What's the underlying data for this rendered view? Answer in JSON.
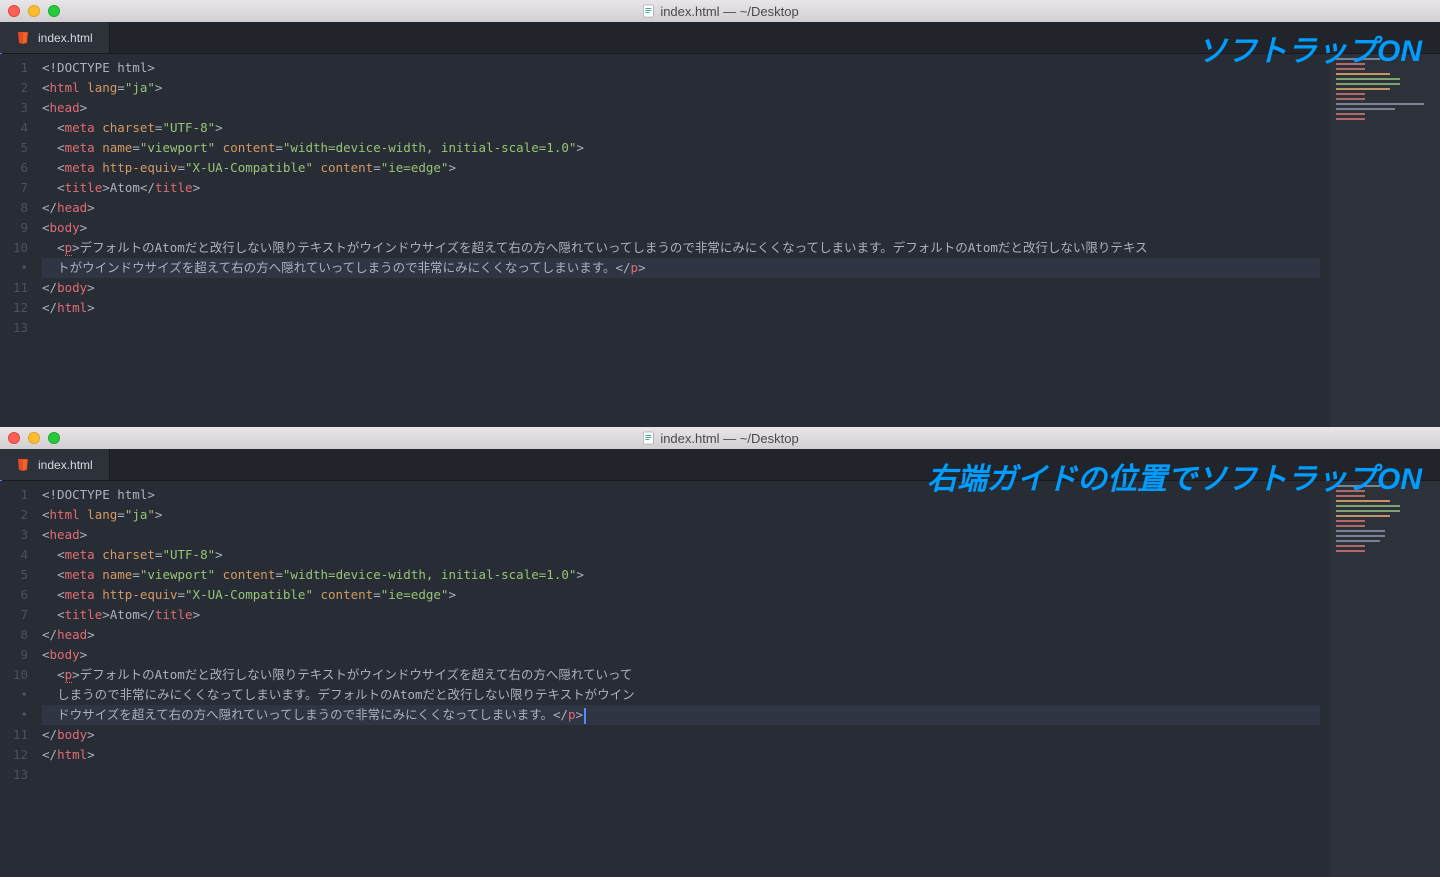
{
  "window1": {
    "title": "index.html — ~/Desktop",
    "tab": "index.html",
    "annotation": "ソフトラップON",
    "lines": [
      "1",
      "2",
      "3",
      "4",
      "5",
      "6",
      "7",
      "8",
      "9",
      "10",
      "•",
      "11",
      "12",
      "13"
    ]
  },
  "window2": {
    "title": "index.html — ~/Desktop",
    "tab": "index.html",
    "annotation": "右端ガイドの位置でソフトラップON",
    "lines": [
      "1",
      "2",
      "3",
      "4",
      "5",
      "6",
      "7",
      "8",
      "9",
      "10",
      "•",
      "•",
      "11",
      "12",
      "13"
    ]
  },
  "code": {
    "doctype": "<!DOCTYPE html>",
    "html_open_1": "<",
    "html_open_tag": "html",
    "html_lang_attr": " lang",
    "html_lang_eq": "=",
    "html_lang_val": "\"ja\"",
    "html_open_2": ">",
    "head_open": "<head>",
    "head_tag": "head",
    "meta1_attr_name": "charset",
    "meta1_attr_val": "\"UTF-8\"",
    "meta2_name": "name",
    "meta2_name_val": "\"viewport\"",
    "meta2_content": "content",
    "meta2_content_val": "\"width=device-width, initial-scale=1.0\"",
    "meta3_httpequiv": "http-equiv",
    "meta3_httpequiv_val": "\"X-UA-Compatible\"",
    "meta3_content": "content",
    "meta3_content_val": "\"ie=edge\"",
    "title_tag": "title",
    "title_text": "Atom",
    "body_tag": "body",
    "p_tag": "p",
    "para_text_full": "デフォルトのAtomだと改行しない限りテキストがウインドウサイズを超えて右の方へ隠れていってしまうので非常にみにくくなってしまいます。デフォルトのAtomだと改行しない限りテキストがウインドウサイズを超えて右の方へ隠れていってしまうので非常にみにくくなってしまいます。",
    "w1_l10": "デフォルトのAtomだと改行しない限りテキストがウインドウサイズを超えて右の方へ隠れていってしまうので非常にみにくくなってしまいます。デフォルトのAtomだと改行しない限りテキス",
    "w1_l10b": "トがウインドウサイズを超えて右の方へ隠れていってしまうので非常にみにくくなってしまいます。",
    "w2_l10": "デフォルトのAtomだと改行しない限りテキストがウインドウサイズを超えて右の方へ隠れていって",
    "w2_l10b": "しまうので非常にみにくくなってしまいます。デフォルトのAtomだと改行しない限りテキストがウイン",
    "w2_l10c": "ドウサイズを超えて右の方へ隠れていってしまうので非常にみにくくなってしまいます。",
    "html_close": "html",
    "body_close": "body",
    "head_close": "head",
    "meta_tag": "meta"
  }
}
